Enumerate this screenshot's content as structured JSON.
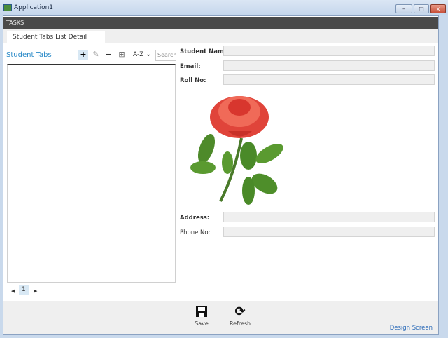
{
  "window": {
    "title": "Application1",
    "minimize": "–",
    "maximize": "□",
    "close": "x"
  },
  "tasks_bar": "TASKS",
  "tab": "Student Tabs List Detail",
  "list": {
    "title": "Student Tabs",
    "sort_label": "A-Z",
    "search_placeholder": "Search",
    "page": "1"
  },
  "form": {
    "student_name_label": "Student Name:",
    "student_name": "",
    "email_label": "Email:",
    "email": "",
    "roll_no_label": "Roll No:",
    "roll_no": "",
    "address_label": "Address:",
    "address": "",
    "phone_label": "Phone No:",
    "phone": ""
  },
  "footer": {
    "save": "Save",
    "refresh": "Refresh",
    "design_screen": "Design Screen"
  }
}
